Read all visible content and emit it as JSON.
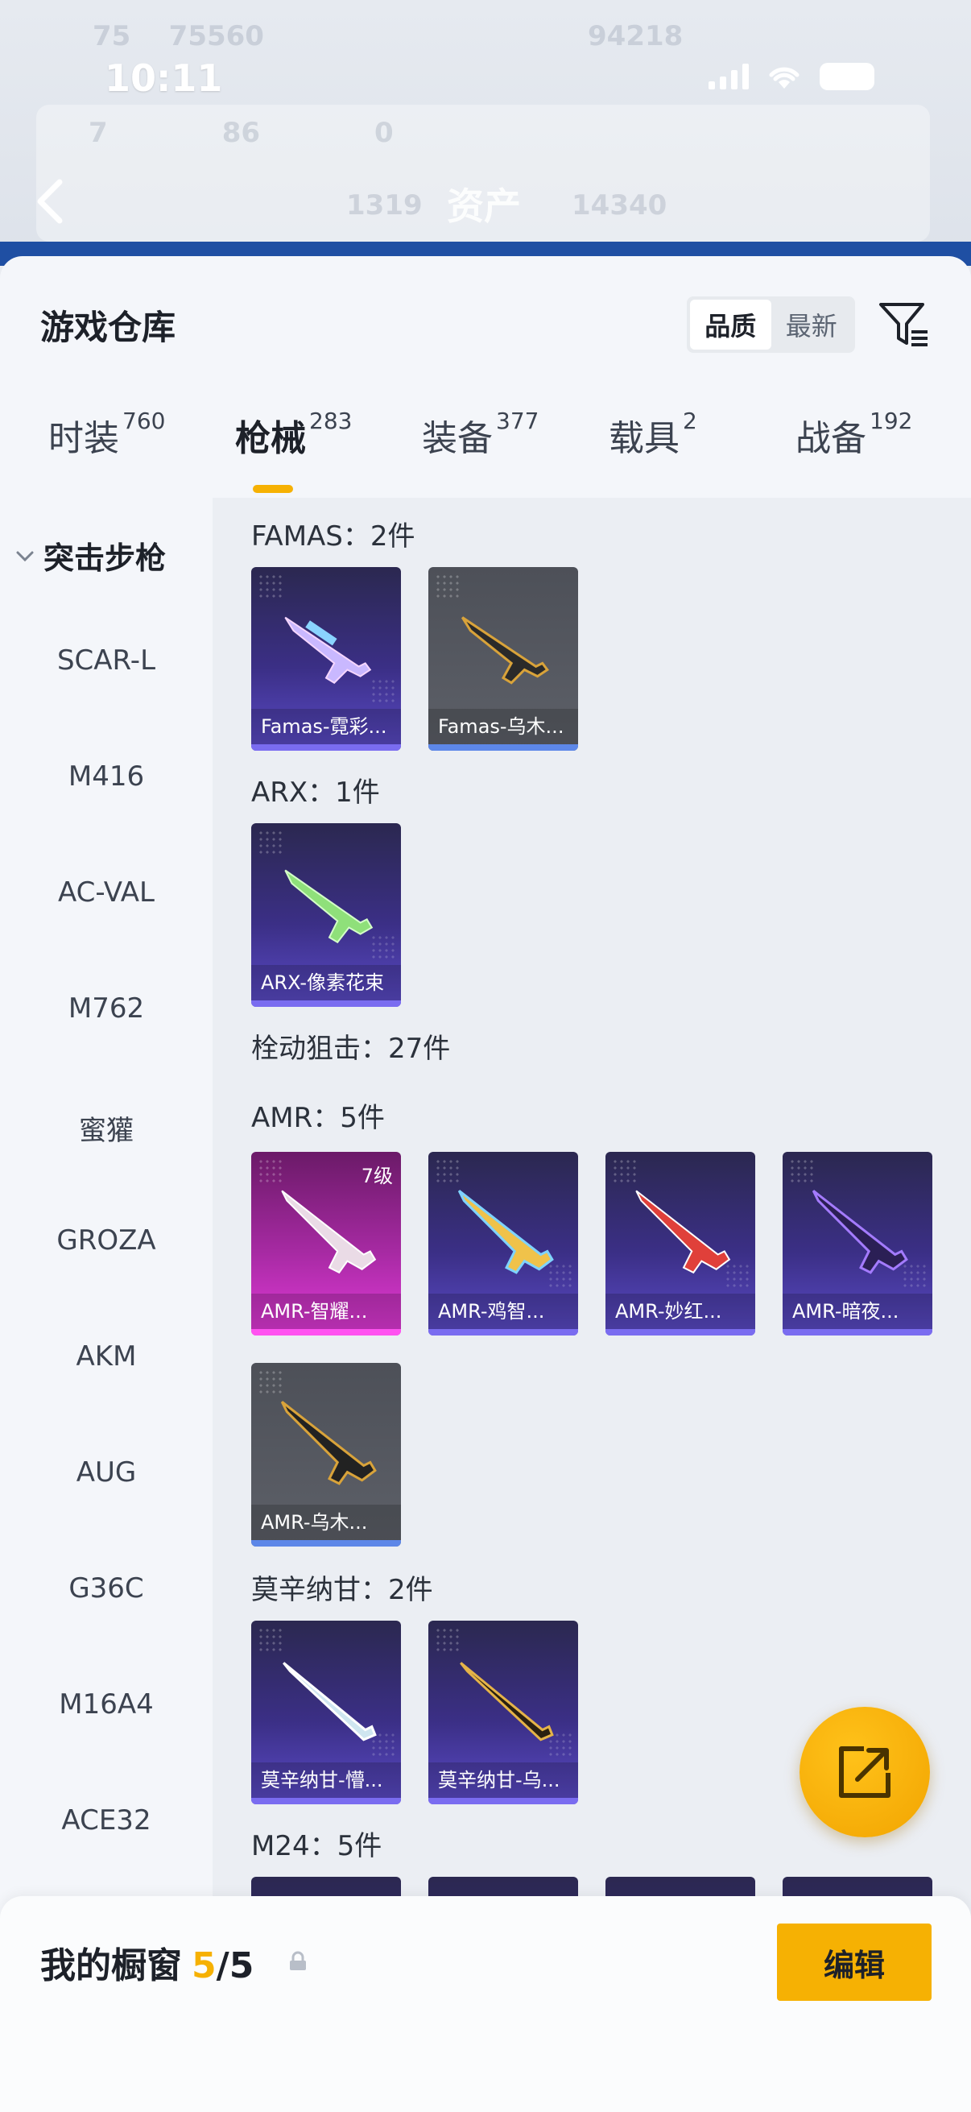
{
  "status_bar": {
    "time": "10:11"
  },
  "background": {
    "title": "资产"
  },
  "sheet": {
    "title": "游戏仓库",
    "sort_options": [
      "品质",
      "最新"
    ],
    "sort_selected": "品质"
  },
  "tabs": [
    {
      "label": "时装",
      "count": "760"
    },
    {
      "label": "枪械",
      "count": "283"
    },
    {
      "label": "装备",
      "count": "377"
    },
    {
      "label": "载具",
      "count": "2"
    },
    {
      "label": "战备",
      "count": "192"
    }
  ],
  "active_tab": "枪械",
  "side_nav": {
    "header": "突击步枪",
    "items": [
      "SCAR-L",
      "M416",
      "AC-VAL",
      "M762",
      "蜜獾",
      "GROZA",
      "AKM",
      "AUG",
      "G36C",
      "M16A4",
      "ACE32"
    ]
  },
  "groups": {
    "famas": {
      "label": "FAMAS：2件",
      "items": [
        "Famas-霓彩...",
        "Famas-乌木..."
      ]
    },
    "arx": {
      "label": "ARX：1件",
      "items": [
        "ARX-像素花束"
      ]
    },
    "bolt_category": {
      "label": "栓动狙击：27件"
    },
    "amr": {
      "label": "AMR：5件",
      "items": [
        "AMR-智耀...",
        "AMR-鸡智...",
        "AMR-妙红...",
        "AMR-暗夜...",
        "AMR-乌木..."
      ],
      "first_level": "7级"
    },
    "mosin": {
      "label": "莫辛纳甘：2件",
      "items": [
        "莫辛纳甘-懵...",
        "莫辛纳甘-乌..."
      ]
    },
    "m24": {
      "label": "M24：5件"
    }
  },
  "showcase": {
    "title": "我的橱窗",
    "current": "5",
    "total": "/5",
    "edit_label": "编辑"
  },
  "colors": {
    "accent": "#f6b103",
    "rare_purple": "#5b4bc8",
    "legendary_pink": "#e23ad9",
    "common_gray": "#5d6068"
  }
}
